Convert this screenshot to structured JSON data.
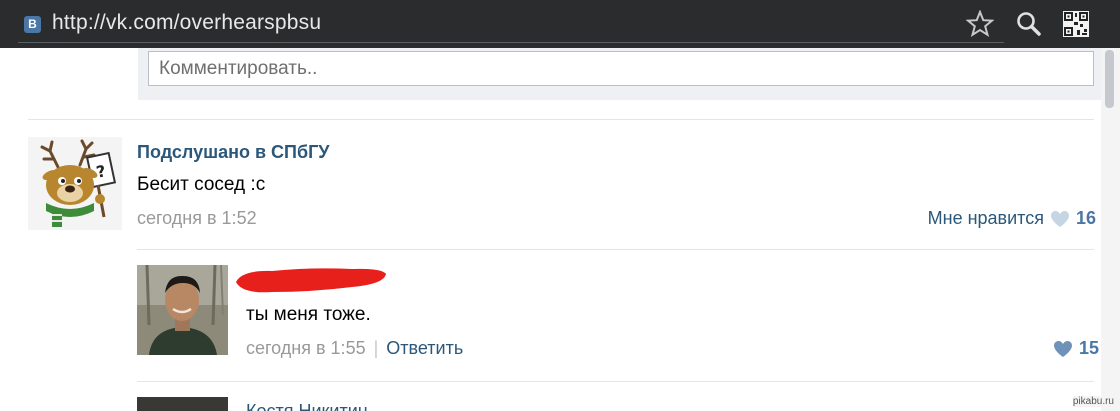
{
  "browser": {
    "url": "http://vk.com/overhearspbsu",
    "favicon_letter": "B",
    "icons": [
      "star-icon",
      "search-icon",
      "qr-code-icon"
    ]
  },
  "comment_box": {
    "placeholder": "Комментировать.."
  },
  "post": {
    "author": "Подслушано в СПбГУ",
    "text": "Бесит сосед :с",
    "time": "сегодня в 1:52",
    "like_label": "Мне нравится",
    "like_count": "16"
  },
  "reply": {
    "text": "ты меня тоже.",
    "time": "сегодня в 1:55",
    "separator": "|",
    "action_label": "Ответить",
    "like_count": "15"
  },
  "next_comment": {
    "author": "Костя Никитин"
  },
  "watermark": "pikabu.ru",
  "colors": {
    "link": "#2b587a",
    "accent": "#4b77a6",
    "muted_text": "#999999",
    "redaction": "#e8201c"
  }
}
